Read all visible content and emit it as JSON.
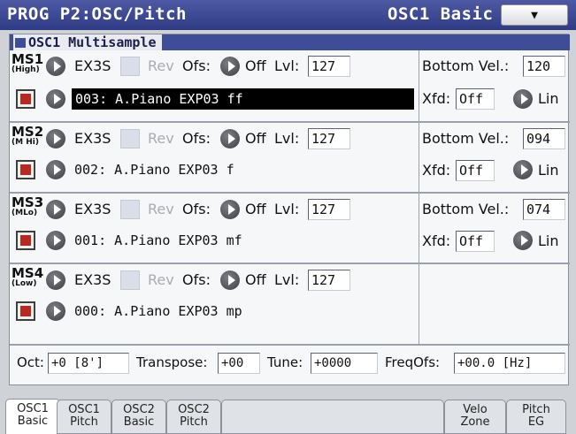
{
  "header": {
    "mode_title": "PROG P2:OSC/Pitch",
    "page_title": "OSC1 Basic",
    "menu_symbol": "▼"
  },
  "section": {
    "title": "OSC1 Multisample"
  },
  "multisamples": [
    {
      "name": "MS1",
      "zone": "(High)",
      "bank": "EX3S",
      "rev_label": "Rev",
      "ofs_label": "Ofs:",
      "ofs_value": "Off",
      "lvl_label": "Lvl:",
      "lvl_value": "127",
      "bottom_vel_label": "Bottom Vel.:",
      "bottom_vel_value": "120",
      "sample": "003: A.Piano EXP03 ff",
      "xfd_label": "Xfd:",
      "xfd_value": "Off",
      "xfd_curve": "Lin"
    },
    {
      "name": "MS2",
      "zone": "(M Hi)",
      "bank": "EX3S",
      "rev_label": "Rev",
      "ofs_label": "Ofs:",
      "ofs_value": "Off",
      "lvl_label": "Lvl:",
      "lvl_value": "127",
      "bottom_vel_label": "Bottom Vel.:",
      "bottom_vel_value": "094",
      "sample": "002: A.Piano EXP03 f",
      "xfd_label": "Xfd:",
      "xfd_value": "Off",
      "xfd_curve": "Lin"
    },
    {
      "name": "MS3",
      "zone": "(MLo)",
      "bank": "EX3S",
      "rev_label": "Rev",
      "ofs_label": "Ofs:",
      "ofs_value": "Off",
      "lvl_label": "Lvl:",
      "lvl_value": "127",
      "bottom_vel_label": "Bottom Vel.:",
      "bottom_vel_value": "074",
      "sample": "001: A.Piano EXP03 mf",
      "xfd_label": "Xfd:",
      "xfd_value": "Off",
      "xfd_curve": "Lin"
    },
    {
      "name": "MS4",
      "zone": "(Low)",
      "bank": "EX3S",
      "rev_label": "Rev",
      "ofs_label": "Ofs:",
      "ofs_value": "Off",
      "lvl_label": "Lvl:",
      "lvl_value": "127",
      "sample": "000: A.Piano EXP03 mp"
    }
  ],
  "bottom": {
    "oct_label": "Oct:",
    "oct_value": "+0 [8']",
    "transpose_label": "Transpose:",
    "transpose_value": "+00",
    "tune_label": "Tune:",
    "tune_value": "+0000",
    "freqofs_label": "FreqOfs:",
    "freqofs_value": "+00.0 [Hz]"
  },
  "tabs": [
    {
      "line1": "OSC1",
      "line2": "Basic"
    },
    {
      "line1": "OSC1",
      "line2": "Pitch"
    },
    {
      "line1": "OSC2",
      "line2": "Basic"
    },
    {
      "line1": "OSC2",
      "line2": "Pitch"
    },
    {
      "line1": "Velo",
      "line2": "Zone"
    },
    {
      "line1": "Pitch",
      "line2": "EG"
    }
  ],
  "colors": {
    "title_bar": "#3f4c98",
    "selected_field": "#000000",
    "enabled_box": "#b82a1f"
  }
}
